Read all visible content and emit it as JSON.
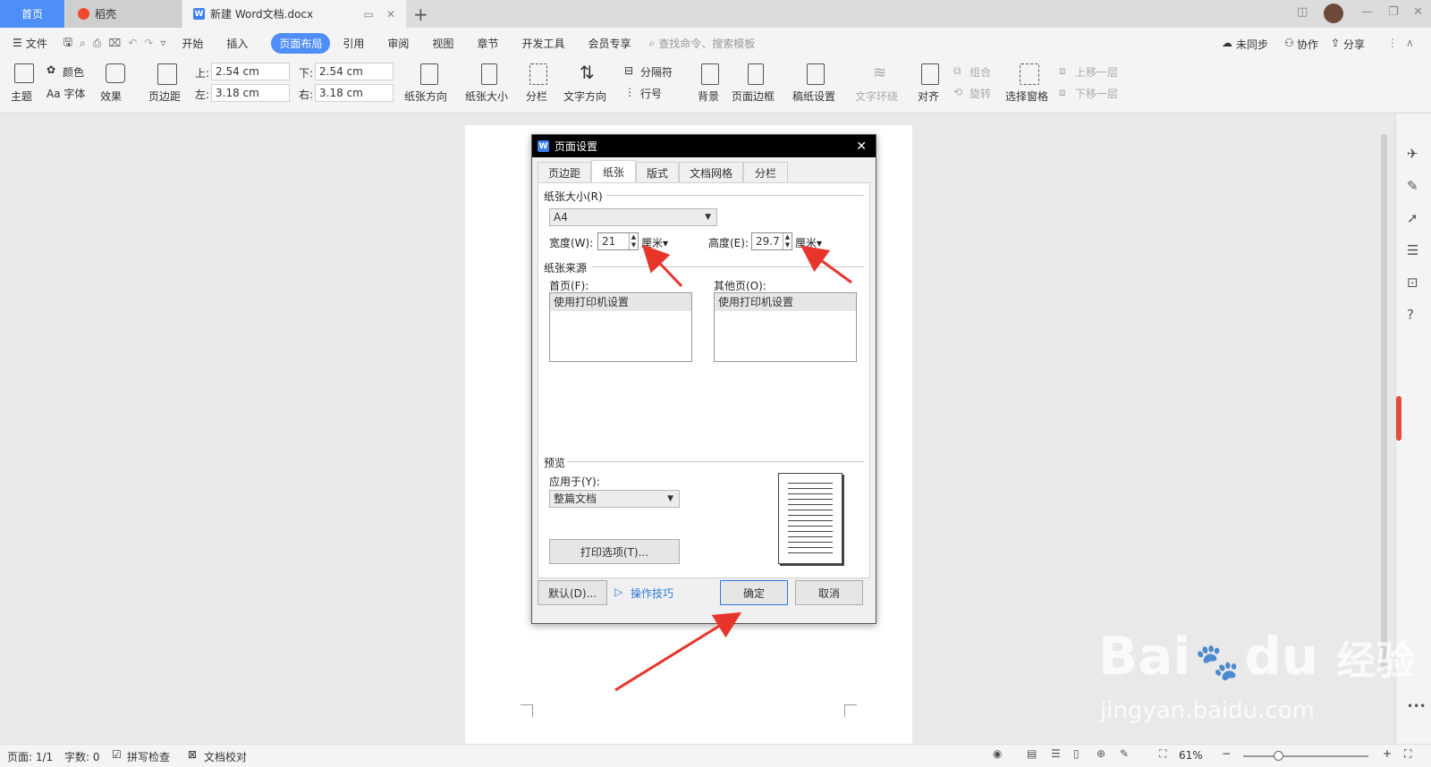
{
  "tabs": {
    "home": "首页",
    "daoke": "稻壳",
    "doc": "新建 Word文档.docx",
    "add": "+"
  },
  "menu": {
    "file": "文件",
    "items": [
      "开始",
      "插入",
      "页面布局",
      "引用",
      "审阅",
      "视图",
      "章节",
      "开发工具",
      "会员专享"
    ],
    "search_placeholder": "查找命令、搜索模板",
    "sync": "未同步",
    "collab": "协作",
    "share": "分享"
  },
  "ribbon": {
    "theme": "主题",
    "color": "颜色",
    "font": "Aa 字体",
    "effect": "效果",
    "margins": "页边距",
    "top_label": "上:",
    "top_val": "2.54 cm",
    "bottom_label": "下:",
    "bottom_val": "2.54 cm",
    "left_label": "左:",
    "left_val": "3.18 cm",
    "right_label": "右:",
    "right_val": "3.18 cm",
    "orientation": "纸张方向",
    "size": "纸张大小",
    "columns": "分栏",
    "text_dir": "文字方向",
    "breaks": "分隔符",
    "line_num": "行号",
    "background": "背景",
    "border": "页面边框",
    "draft": "稿纸设置",
    "wrap": "文字环绕",
    "align": "对齐",
    "group": "组合",
    "rotate": "旋转",
    "select_pane": "选择窗格",
    "bring_forward": "上移一层",
    "send_backward": "下移一层"
  },
  "dialog": {
    "title": "页面设置",
    "tabs": [
      "页边距",
      "纸张",
      "版式",
      "文档网格",
      "分栏"
    ],
    "paper_size_label": "纸张大小(R)",
    "paper_size_value": "A4",
    "width_label": "宽度(W):",
    "width_value": "21",
    "width_unit": "厘米",
    "height_label": "高度(E):",
    "height_value": "29.7",
    "height_unit": "厘米",
    "source_label": "纸张来源",
    "first_page_label": "首页(F):",
    "first_page_value": "使用打印机设置",
    "other_pages_label": "其他页(O):",
    "other_pages_value": "使用打印机设置",
    "preview_label": "预览",
    "apply_to_label": "应用于(Y):",
    "apply_to_value": "整篇文档",
    "print_options": "打印选项(T)...",
    "default_button": "默认(D)...",
    "tips": "操作技巧",
    "ok": "确定",
    "cancel": "取消"
  },
  "status": {
    "page": "页面: 1/1",
    "words": "字数: 0",
    "spell": "拼写检查",
    "proof": "文档校对",
    "zoom": "61%"
  },
  "watermark": {
    "brand": "Bai",
    "brand2": "du",
    "cn": "经验",
    "url": "jingyan.baidu.com"
  },
  "colors": {
    "accent": "#4e8ef7",
    "arrow": "#e8352b"
  }
}
